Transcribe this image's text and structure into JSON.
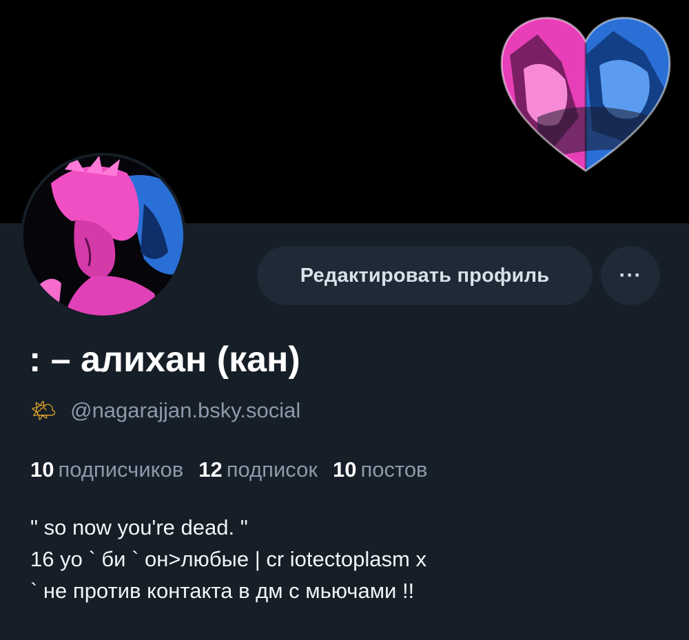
{
  "profile": {
    "display_name": ": – алихан (кан)",
    "handle_emoji": "🌤",
    "handle": "@nagarajjan.bsky.social",
    "edit_button_label": "Редактировать профиль",
    "more_button_label": "···"
  },
  "stats": {
    "followers_count": "10",
    "followers_label": "подписчиков",
    "following_count": "12",
    "following_label": "подписок",
    "posts_count": "10",
    "posts_label": "постов"
  },
  "bio": {
    "lines": [
      "\" so now you're dead. \"",
      "16 yo ` би ` он>любые | cr iotectoplasm x",
      "` не против контакта в дм с мьючами !!"
    ]
  },
  "colors": {
    "background": "#161e27",
    "banner": "#000000",
    "button_bg": "#1e2a36",
    "accent_pink": "#e83fb8",
    "accent_blue": "#2a6fd6",
    "muted_text": "#8c9aab"
  }
}
